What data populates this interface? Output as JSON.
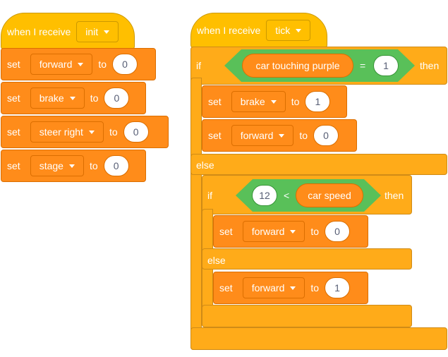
{
  "left_script": {
    "hat": {
      "label": "when I receive",
      "message": "init"
    },
    "blocks": [
      {
        "set": "set",
        "variable": "forward",
        "to": "to",
        "value": "0"
      },
      {
        "set": "set",
        "variable": "brake",
        "to": "to",
        "value": "0"
      },
      {
        "set": "set",
        "variable": "steer right",
        "to": "to",
        "value": "0"
      },
      {
        "set": "set",
        "variable": "stage",
        "to": "to",
        "value": "0"
      }
    ]
  },
  "right_script": {
    "hat": {
      "label": "when I receive",
      "message": "tick"
    },
    "if_outer": {
      "if": "if",
      "then": "then",
      "else": "else",
      "condition": {
        "left": "car touching purple",
        "op": "=",
        "right": "1"
      },
      "then_blocks": [
        {
          "set": "set",
          "variable": "brake",
          "to": "to",
          "value": "1"
        },
        {
          "set": "set",
          "variable": "forward",
          "to": "to",
          "value": "0"
        }
      ],
      "inner_if": {
        "if": "if",
        "then": "then",
        "else": "else",
        "condition": {
          "left": "12",
          "op": "<",
          "right": "car speed"
        },
        "then_blocks": [
          {
            "set": "set",
            "variable": "forward",
            "to": "to",
            "value": "0"
          }
        ],
        "else_blocks": [
          {
            "set": "set",
            "variable": "forward",
            "to": "to",
            "value": "1"
          }
        ]
      }
    }
  },
  "colors": {
    "events": "#FFBF00",
    "variables": "#FF8C1A",
    "control": "#FFAB19",
    "operators": "#59C059",
    "text": "#FFFFFF",
    "input_text": "#575E75"
  }
}
